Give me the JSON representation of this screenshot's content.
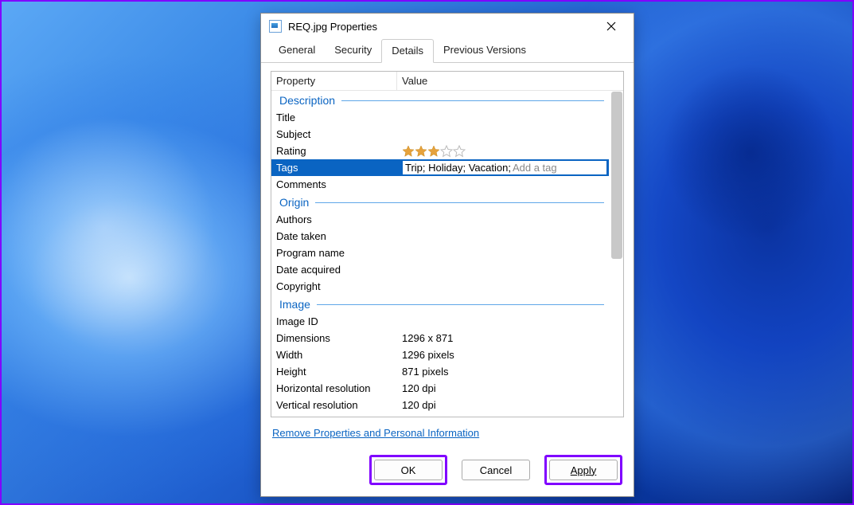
{
  "window": {
    "title": "REQ.jpg Properties"
  },
  "tabs": {
    "general": "General",
    "security": "Security",
    "details": "Details",
    "previous": "Previous Versions"
  },
  "columns": {
    "property": "Property",
    "value": "Value"
  },
  "groups": {
    "description": "Description",
    "origin": "Origin",
    "image": "Image"
  },
  "props": {
    "title": "Title",
    "subject": "Subject",
    "rating": "Rating",
    "tags": "Tags",
    "comments": "Comments",
    "authors": "Authors",
    "date_taken": "Date taken",
    "program_name": "Program name",
    "date_acquired": "Date acquired",
    "copyright": "Copyright",
    "image_id": "Image ID",
    "dimensions": "Dimensions",
    "width": "Width",
    "height": "Height",
    "hres": "Horizontal resolution",
    "vres": "Vertical resolution"
  },
  "values": {
    "rating_filled": 3,
    "tags_text": "Trip; Holiday; Vacation; ",
    "tags_hint": "Add a tag",
    "dimensions": "1296 x 871",
    "width": "1296 pixels",
    "height": "871 pixels",
    "hres": "120 dpi",
    "vres": "120 dpi"
  },
  "link": "Remove Properties and Personal Information",
  "buttons": {
    "ok": "OK",
    "cancel": "Cancel",
    "apply": "Apply"
  },
  "colors": {
    "accent": "#0a64c2",
    "highlight_border": "#8000ff"
  }
}
